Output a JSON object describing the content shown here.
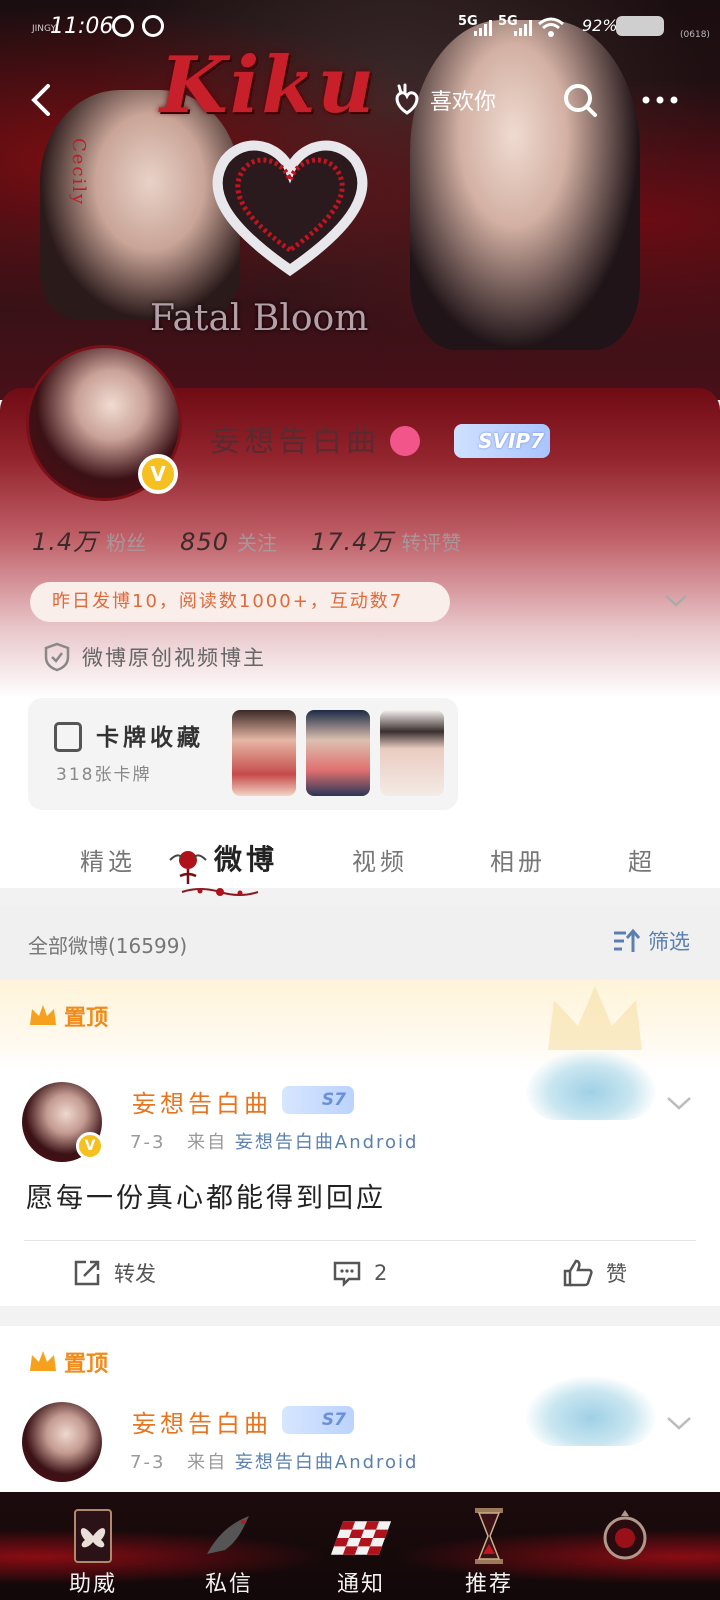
{
  "status_bar": {
    "carrier": "JINGYI",
    "time": "11:06",
    "network_1": "5G",
    "network_2": "5G",
    "battery": "92%",
    "device_code": "(0618)"
  },
  "banner": {
    "title_text": "Kiku",
    "subtitle_text": "Fatal Bloom",
    "side_text": "Cecily"
  },
  "nav": {
    "like_label": "喜欢你"
  },
  "profile": {
    "username": "妄想告白曲",
    "vip_label": "SVIP7",
    "verified_badge": "V",
    "stats": [
      {
        "value": "1.4万",
        "label": "粉丝"
      },
      {
        "value": "850",
        "label": "关注"
      },
      {
        "value": "17.4万",
        "label": "转评赞"
      }
    ],
    "activity_text": "昨日发博10，阅读数1000+，互动数7",
    "certification": "微博原创视频博主",
    "card_collection": {
      "title": "卡牌收藏",
      "count_text": "318张卡牌"
    }
  },
  "tabs": [
    {
      "label": "精选",
      "active": false
    },
    {
      "label": "微博",
      "active": true
    },
    {
      "label": "视频",
      "active": false
    },
    {
      "label": "相册",
      "active": false
    },
    {
      "label": "超",
      "active": false
    }
  ],
  "list_header": {
    "count_text": "全部微博(16599)",
    "filter_label": "筛选"
  },
  "posts": [
    {
      "pinned_label": "置顶",
      "author": "妄想告白曲",
      "vip": "S7",
      "date": "7-3",
      "source_prefix": "来自",
      "source": "妄想告白曲Android",
      "text": "愿每一份真心都能得到回应",
      "actions": {
        "repost": "转发",
        "comments": "2",
        "like": "赞"
      }
    },
    {
      "pinned_label": "置顶",
      "author": "妄想告白曲",
      "vip": "S7",
      "date": "7-3",
      "source_prefix": "来自",
      "source": "妄想告白曲Android"
    }
  ],
  "bottom_nav": [
    {
      "label": "助威",
      "icon": "butterfly-card-icon"
    },
    {
      "label": "私信",
      "icon": "bird-icon"
    },
    {
      "label": "通知",
      "icon": "checkerboard-icon"
    },
    {
      "label": "推荐",
      "icon": "hourglass-icon"
    },
    {
      "label": "",
      "icon": "rose-mirror-icon"
    }
  ],
  "colors": {
    "accent_orange": "#e8741e",
    "link_blue": "#5a7fb0",
    "pin_orange": "#f08a1a",
    "banner_red": "#c8202a"
  }
}
